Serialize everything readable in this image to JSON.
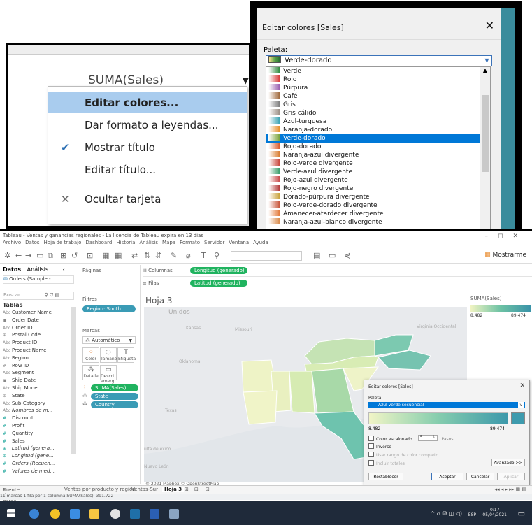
{
  "dialog_top": {
    "title": "Editar colores [Sales]",
    "close": "✕",
    "palette_label": "Paleta:",
    "selected_palette": "Verde-dorado",
    "options": [
      {
        "label": "Verde",
        "color": "#2e8b3e"
      },
      {
        "label": "Rojo",
        "color": "#d83a3a"
      },
      {
        "label": "Púrpura",
        "color": "#9a5fb0"
      },
      {
        "label": "Café",
        "color": "#a0693b"
      },
      {
        "label": "Gris",
        "color": "#7d7d7d"
      },
      {
        "label": "Gris cálido",
        "color": "#9b8f85"
      },
      {
        "label": "Azul-turquesa",
        "color": "#3aa3b3"
      },
      {
        "label": "Naranja-dorado",
        "color": "#e7902b"
      },
      {
        "label": "Verde-dorado",
        "color": "#7aa33a"
      },
      {
        "label": "Rojo-dorado",
        "color": "#d85a2b"
      },
      {
        "label": "Naranja-azul divergente",
        "color": "#d97c2f"
      },
      {
        "label": "Rojo-verde divergente",
        "color": "#c9453a"
      },
      {
        "label": "Verde-azul divergente",
        "color": "#3a9c6a"
      },
      {
        "label": "Rojo-azul divergente",
        "color": "#c84a4a"
      },
      {
        "label": "Rojo-negro divergente",
        "color": "#b33a3a"
      },
      {
        "label": "Dorado-púrpura divergente",
        "color": "#c9a23a"
      },
      {
        "label": "Rojo-verde-dorado divergente",
        "color": "#c8553a"
      },
      {
        "label": "Amanecer-atardecer divergente",
        "color": "#e37a3a"
      },
      {
        "label": "Naranja-azul-blanco divergente",
        "color": "#d98a4a"
      }
    ]
  },
  "context_menu": {
    "field": "SUMA(Sales)",
    "items": [
      {
        "label": "Editar colores...",
        "icon": ""
      },
      {
        "label": "Dar formato a leyendas...",
        "icon": ""
      },
      {
        "label": "Mostrar título",
        "icon": "✔"
      },
      {
        "label": "Editar título...",
        "icon": ""
      },
      {
        "label": "Ocultar tarjeta",
        "icon": "✕"
      }
    ]
  },
  "main": {
    "title": "Tableau - Ventas y ganancias regionales - La licencia de Tableau expira en 13 días",
    "menu": [
      "Archivo",
      "Datos",
      "Hoja de trabajo",
      "Dashboard",
      "Historia",
      "Análisis",
      "Mapa",
      "Formato",
      "Servidor",
      "Ventana",
      "Ayuda"
    ],
    "show_me": "Mostrarme",
    "left_tabs": [
      "Datos",
      "Análisis"
    ],
    "data_source": "Orders (Sample - ...",
    "search_placeholder": "Buscar",
    "tables_label": "Tablas",
    "fields": [
      {
        "label": "Customer Name",
        "icon": "Abc"
      },
      {
        "label": "Order Date",
        "icon": "▣"
      },
      {
        "label": "Order ID",
        "icon": "Abc"
      },
      {
        "label": "Postal Code",
        "icon": "⊕"
      },
      {
        "label": "Product ID",
        "icon": "Abc"
      },
      {
        "label": "Product Name",
        "icon": "Abc"
      },
      {
        "label": "Region",
        "icon": "Abc"
      },
      {
        "label": "Row ID",
        "icon": "#"
      },
      {
        "label": "Segment",
        "icon": "Abc"
      },
      {
        "label": "Ship Date",
        "icon": "▣"
      },
      {
        "label": "Ship Mode",
        "icon": "Abc"
      },
      {
        "label": "State",
        "icon": "⊕"
      },
      {
        "label": "Sub-Category",
        "icon": "Abc"
      },
      {
        "label": "Nombres de m...",
        "icon": "Abc"
      },
      {
        "label": "Discount",
        "icon": "#"
      },
      {
        "label": "Profit",
        "icon": "#"
      },
      {
        "label": "Quantity",
        "icon": "#"
      },
      {
        "label": "Sales",
        "icon": "#"
      },
      {
        "label": "Latitud (genera...",
        "icon": "⊕"
      },
      {
        "label": "Longitud (gene...",
        "icon": "⊕"
      },
      {
        "label": "Orders (Recuen...",
        "icon": "#"
      },
      {
        "label": "Valores de med...",
        "icon": "#"
      }
    ],
    "pages_label": "Páginas",
    "filters_label": "Filtros",
    "filter_pill": "Region: South",
    "marks_label": "Marcas",
    "marks_type": "Automático",
    "mark_buttons": [
      "Color",
      "Tamaño",
      "Etiqueta",
      "Detalle",
      "Descri... emerg..."
    ],
    "mark_pills": [
      "SUMA(Sales)",
      "State",
      "Country"
    ],
    "columns_label": "Columnas",
    "columns_pill": "Longitud (generado)",
    "rows_label": "Filas",
    "rows_pill": "Latitud (generado)",
    "sheet_title": "Hoja 3",
    "legend_title": "SUMA(Sales)",
    "legend_min": "8.482",
    "legend_max": "89.474",
    "map_labels": [
      "Unidos",
      "Kansas",
      "Missouri",
      "Oklahoma",
      "Texas",
      "Virginia Occidental",
      "Nuevo León",
      "ulfa de éxico"
    ],
    "copyright": "© 2021 Mapbox © OpenStreetMap",
    "bottom_tabs": [
      "Fuente de datos",
      "Ventas por producto y región",
      "Ventas-Sur",
      "Hoja 3"
    ],
    "status": "11 marcas   1 fila por 1 columna   SUMA(Sales): 391.722"
  },
  "dialog_small": {
    "title": "Editar colores [Sales]",
    "palette_label": "Paleta:",
    "selected_palette": "Azul-verde secuencial",
    "min": "8.482",
    "max": "89.474",
    "stepped": "Color escalonado",
    "steps_value": "5",
    "steps_label": "Pasos",
    "reverse": "Inverso",
    "full_range": "Usar rango de color completo",
    "include_totals": "Incluir totales",
    "advanced": "Avanzado >>",
    "reset": "Restablecer",
    "ok": "Aceptar",
    "cancel": "Cancelar",
    "apply": "Aplicar"
  },
  "taskbar": {
    "lang": "ESP",
    "time": "0:17",
    "date": "05/04/2021"
  }
}
